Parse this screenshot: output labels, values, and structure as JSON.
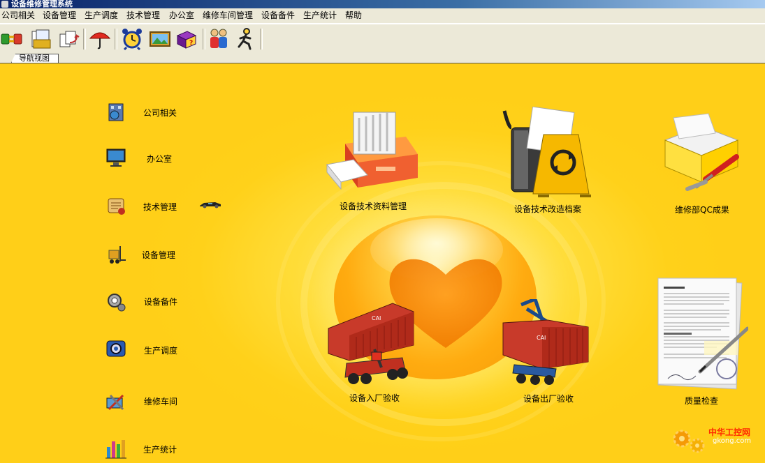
{
  "window": {
    "title": "设备维修管理系统"
  },
  "menu": [
    "公司相关",
    "设备管理",
    "生产调度",
    "技术管理",
    "办公室",
    "维修车间管理",
    "设备备件",
    "生产统计",
    "帮助"
  ],
  "toolbar": {
    "buttons": [
      "connect-icon",
      "documents-icon",
      "files-arrow-icon",
      "umbrella-icon",
      "alarm-clock-icon",
      "picture-frame-icon",
      "help-book-icon",
      "users-icon",
      "runner-icon"
    ]
  },
  "tabs": {
    "active": "导航视图"
  },
  "sidebar": {
    "items": [
      {
        "label": "公司相关",
        "icon": "building-icon"
      },
      {
        "label": "办公室",
        "icon": "monitor-icon"
      },
      {
        "label": "技术管理",
        "icon": "scroll-icon"
      },
      {
        "label": "设备管理",
        "icon": "forklift-icon"
      },
      {
        "label": "设备备件",
        "icon": "gear-parts-icon"
      },
      {
        "label": "生产调度",
        "icon": "dispatch-gear-icon"
      },
      {
        "label": "维修车间",
        "icon": "tools-icon"
      },
      {
        "label": "生产统计",
        "icon": "bar-chart-icon"
      }
    ]
  },
  "tiles": [
    {
      "label": "设备技术资料管理",
      "icon": "file-drawer-icon"
    },
    {
      "label": "设备技术改造档案",
      "icon": "bin-refresh-icon"
    },
    {
      "label": "维修部QC成果",
      "icon": "toolbox-icon"
    },
    {
      "label": "设备入厂验收",
      "icon": "container-truck-in-icon"
    },
    {
      "label": "设备出厂验收",
      "icon": "container-truck-out-icon"
    },
    {
      "label": "质量检查",
      "icon": "document-pen-icon"
    }
  ],
  "watermark": {
    "name": "中华工控网",
    "domain": "gkong.com"
  },
  "colors": {
    "background": "#ffd21a",
    "accent": "#ff8c00",
    "titlebar": "#0a246a"
  }
}
